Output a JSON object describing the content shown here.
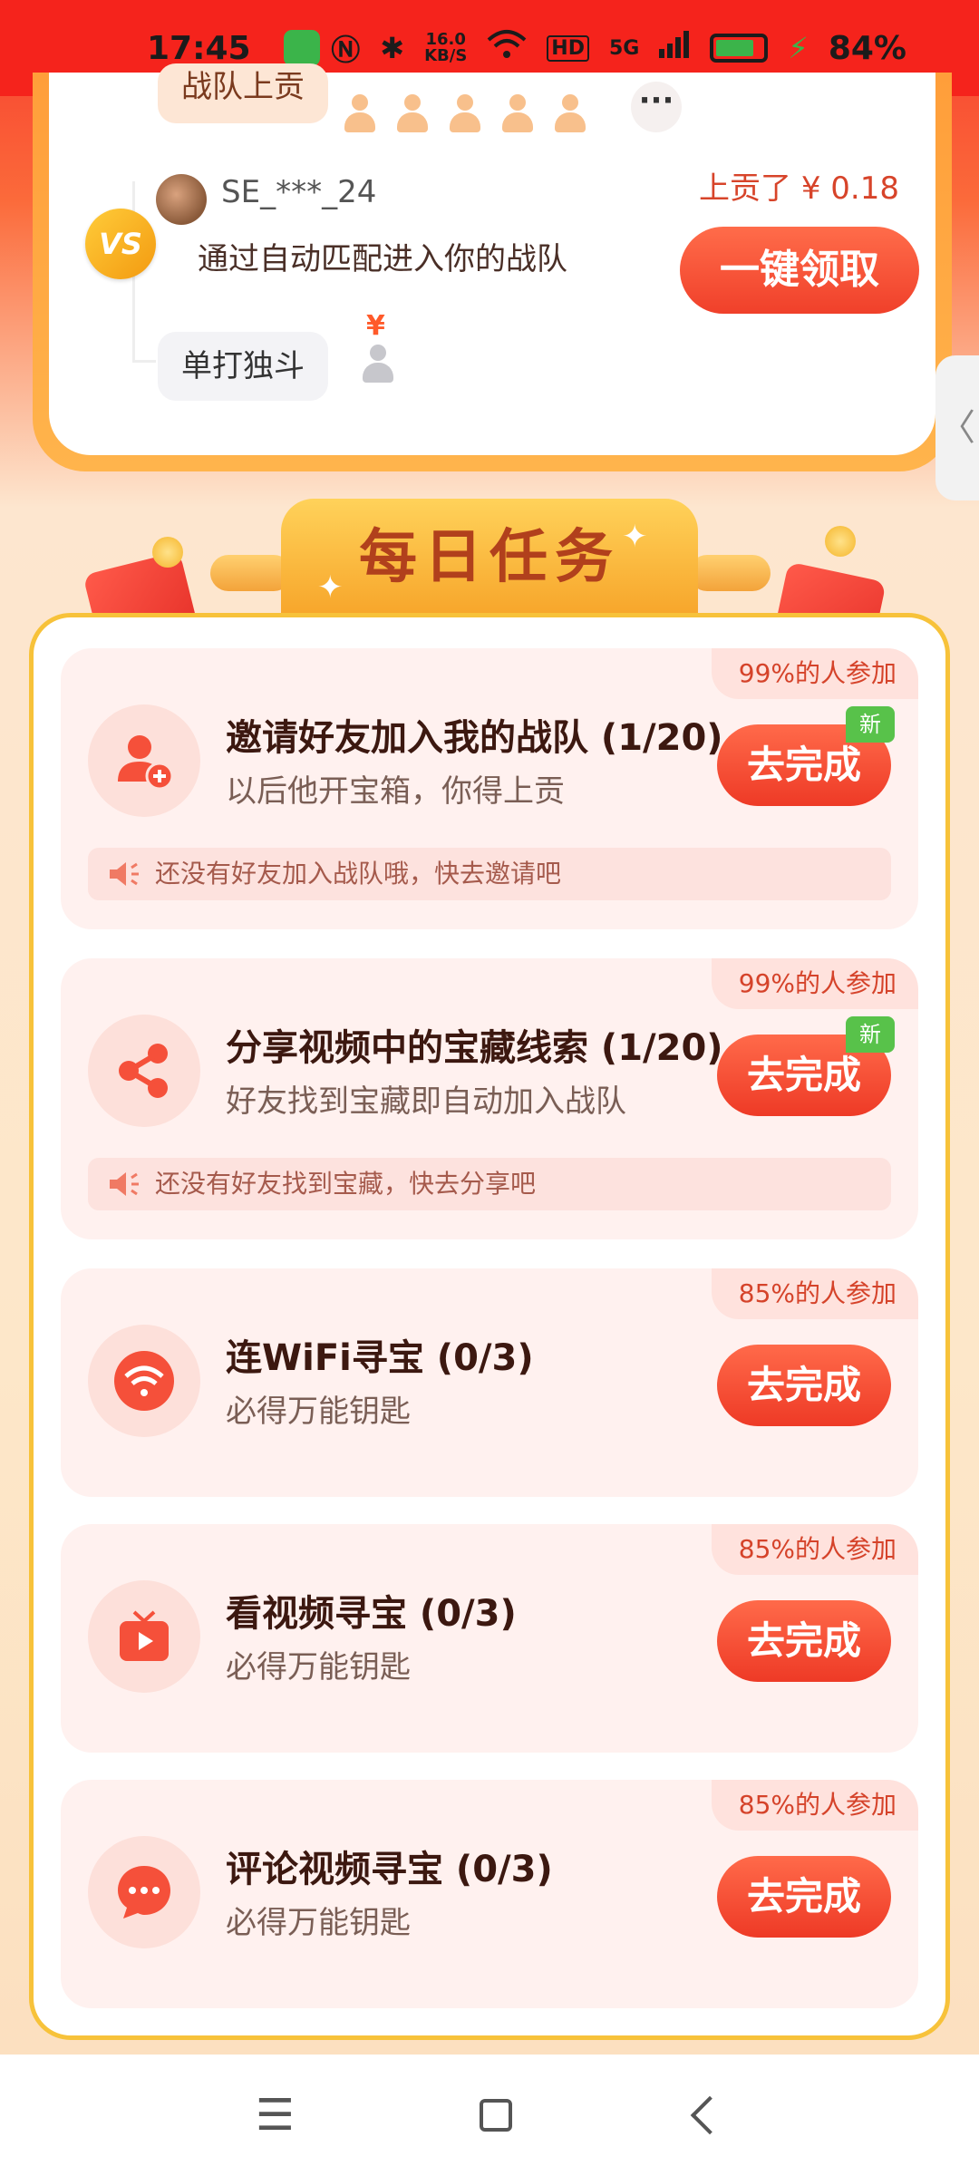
{
  "status_bar": {
    "time": "17:45",
    "network_speed": "16.0",
    "network_speed_unit": "KB/S",
    "hd_label": "HD",
    "signal_label": "5G",
    "battery_percent": "84%",
    "battery_level": 0.84
  },
  "team_card": {
    "team_pill": "战队上贡",
    "more_label": "···",
    "username": "SE_***_24",
    "vs_label": "VS",
    "match_text": "通过自动匹配进入你的战队",
    "contribution_text": "上贡了 ¥ 0.18",
    "claim_button": "一键领取",
    "solo_pill": "单打独斗",
    "solo_yen": "¥"
  },
  "side_tab_label": "〈",
  "daily_tasks": {
    "header_title": "每日任务",
    "tasks": [
      {
        "participation": "99%的人参加",
        "title": "邀请好友加入我的战队 (1/20)",
        "desc": "以后他开宝箱，你得上贡",
        "button": "去完成",
        "badge": "新",
        "notice": "还没有好友加入战队哦，快去邀请吧",
        "icon": "add-user-icon"
      },
      {
        "participation": "99%的人参加",
        "title": "分享视频中的宝藏线索 (1/20)",
        "desc": "好友找到宝藏即自动加入战队",
        "button": "去完成",
        "badge": "新",
        "notice": "还没有好友找到宝藏，快去分享吧",
        "icon": "share-icon"
      },
      {
        "participation": "85%的人参加",
        "title": "连WiFi寻宝 (0/3)",
        "desc": "必得万能钥匙",
        "button": "去完成",
        "icon": "wifi-icon"
      },
      {
        "participation": "85%的人参加",
        "title": "看视频寻宝 (0/3)",
        "desc": "必得万能钥匙",
        "button": "去完成",
        "icon": "tv-play-icon"
      },
      {
        "participation": "85%的人参加",
        "title": "评论视频寻宝 (0/3)",
        "desc": "必得万能钥匙",
        "button": "去完成",
        "icon": "comment-icon"
      }
    ]
  },
  "nav": {
    "menu_label": "☰"
  },
  "colors": {
    "accent_red": "#ee3a26",
    "panel_border": "#f7c23a",
    "new_badge": "#58c24a"
  }
}
